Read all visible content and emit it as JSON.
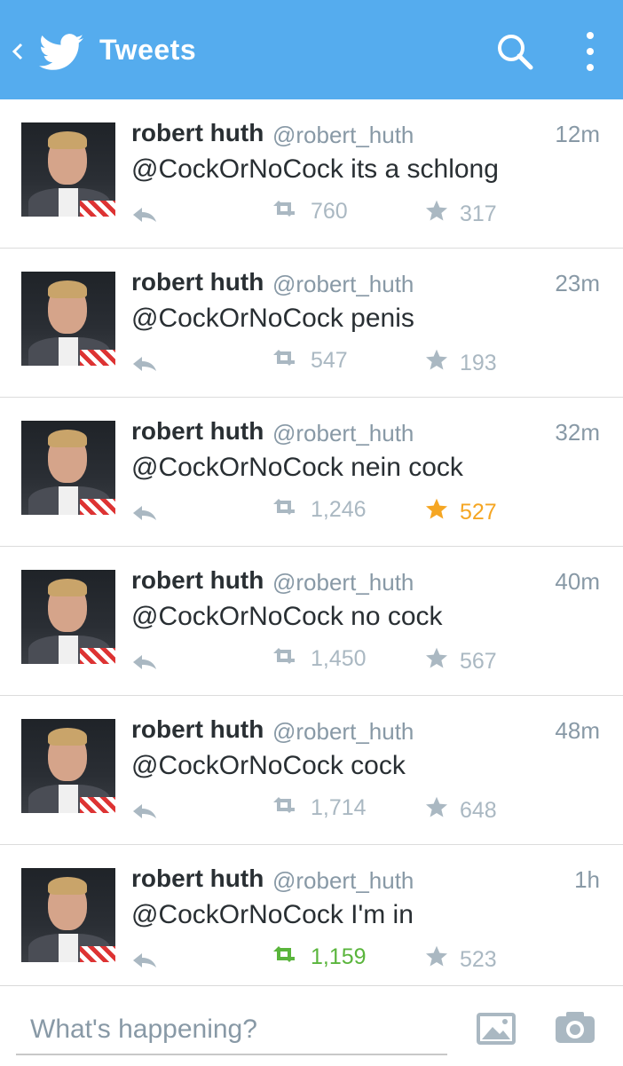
{
  "header": {
    "title": "Tweets",
    "background": "#55acee",
    "icons": [
      "back-icon",
      "twitter-bird-icon",
      "search-icon",
      "overflow-menu-icon"
    ]
  },
  "tweets": [
    {
      "name": "robert huth",
      "handle": "@robert_huth",
      "time": "12m",
      "text": "@CockOrNoCock its a schlong",
      "retweets": "760",
      "favorites": "317",
      "favorited": false,
      "retweeted": false
    },
    {
      "name": "robert huth",
      "handle": "@robert_huth",
      "time": "23m",
      "text": "@CockOrNoCock penis",
      "retweets": "547",
      "favorites": "193",
      "favorited": false,
      "retweeted": false
    },
    {
      "name": "robert huth",
      "handle": "@robert_huth",
      "time": "32m",
      "text": "@CockOrNoCock nein cock",
      "retweets": "1,246",
      "favorites": "527",
      "favorited": true,
      "retweeted": false
    },
    {
      "name": "robert huth",
      "handle": "@robert_huth",
      "time": "40m",
      "text": "@CockOrNoCock no cock",
      "retweets": "1,450",
      "favorites": "567",
      "favorited": false,
      "retweeted": false
    },
    {
      "name": "robert huth",
      "handle": "@robert_huth",
      "time": "48m",
      "text": "@CockOrNoCock cock",
      "retweets": "1,714",
      "favorites": "648",
      "favorited": false,
      "retweeted": false
    },
    {
      "name": "robert huth",
      "handle": "@robert_huth",
      "time": "1h",
      "text": "@CockOrNoCock I'm in",
      "retweets": "1,159",
      "favorites": "523",
      "favorited": false,
      "retweeted": true
    }
  ],
  "composer": {
    "placeholder": "What's happening?",
    "icons": [
      "photo-icon",
      "camera-icon"
    ]
  },
  "colors": {
    "accent": "#55acee",
    "favorite_active": "#f5a623",
    "retweet_active": "#5ab53c"
  }
}
